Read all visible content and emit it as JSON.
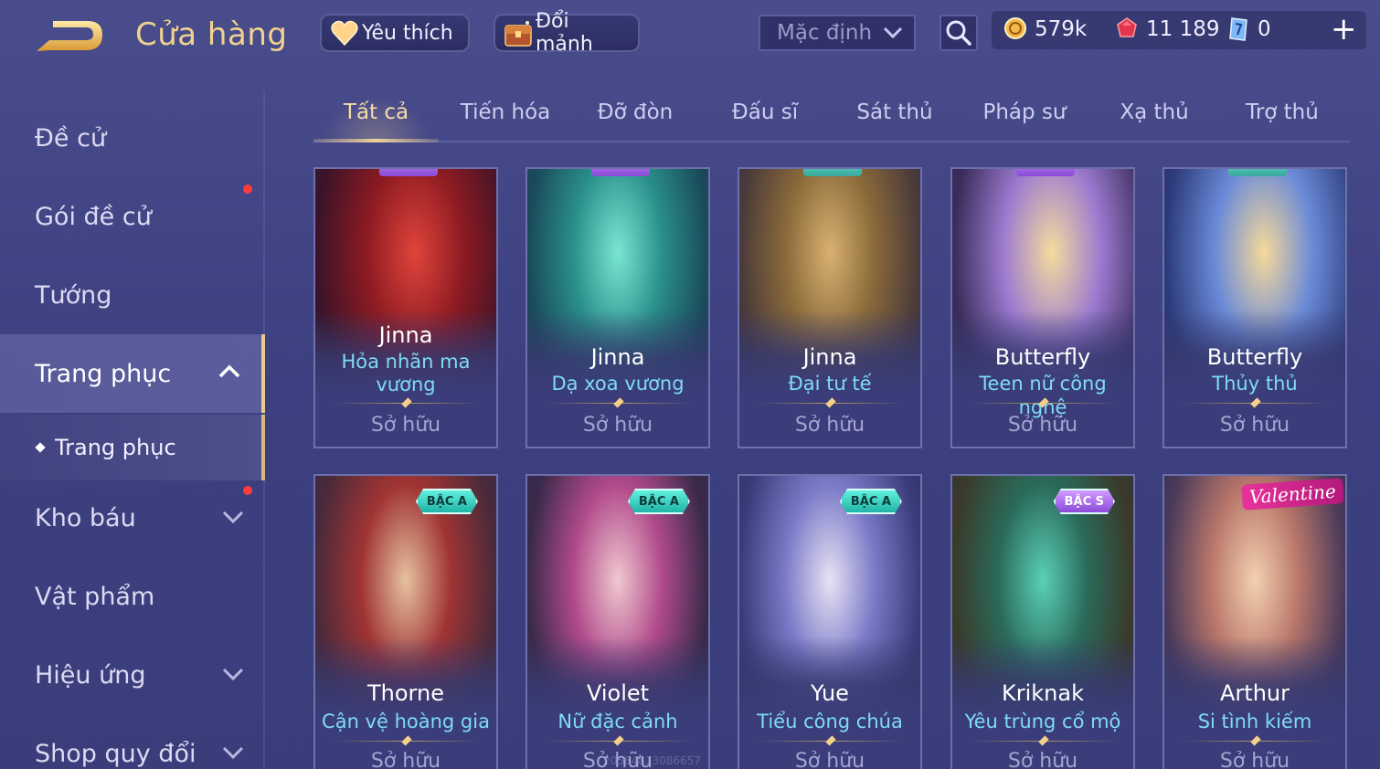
{
  "header": {
    "title": "Cửa hàng",
    "favorite_label": "Yêu thích",
    "trade_label": "Đổi mảnh",
    "sort_value": "Mặc định",
    "gold": "579k",
    "ruby": "11 189",
    "voucher": "0"
  },
  "sidebar": {
    "items": [
      {
        "label": "Đề cử"
      },
      {
        "label": "Gói đề cử",
        "badge": true
      },
      {
        "label": "Tướng"
      },
      {
        "label": "Trang phục",
        "expanded": true
      },
      {
        "label": "Kho báu",
        "badge": true
      },
      {
        "label": "Vật phẩm"
      },
      {
        "label": "Hiệu ứng"
      },
      {
        "label": "Shop quy đổi"
      }
    ],
    "sub_item": "Trang phục"
  },
  "tabs": [
    "Tất cả",
    "Tiến hóa",
    "Đỡ đòn",
    "Đấu sĩ",
    "Sát thủ",
    "Pháp sư",
    "Xạ thủ",
    "Trợ thủ"
  ],
  "active_tab": "Tất cả",
  "cards": [
    {
      "hero": "Jinna",
      "skin_line1": "Hỏa nhãn ma",
      "skin_line2": "vương",
      "status": "Sở hữu"
    },
    {
      "hero": "Jinna",
      "skin_line1": "Dạ xoa vương",
      "status": "Sở hữu"
    },
    {
      "hero": "Jinna",
      "skin_line1": "Đại tư tế",
      "status": "Sở hữu"
    },
    {
      "hero": "Butterfly",
      "skin_line1": "Teen nữ công nghệ",
      "status": "Sở hữu"
    },
    {
      "hero": "Butterfly",
      "skin_line1": "Thủy thủ",
      "status": "Sở hữu"
    },
    {
      "hero": "Thorne",
      "skin_line1": "Cận vệ hoàng gia",
      "status": "Sở hữu",
      "tier": "BẬC A"
    },
    {
      "hero": "Violet",
      "skin_line1": "Nữ đặc cảnh",
      "status": "Sở hữu",
      "tier": "BẬC A"
    },
    {
      "hero": "Yue",
      "skin_line1": "Tiểu công chúa",
      "status": "Sở hữu",
      "tier": "BẬC A"
    },
    {
      "hero": "Kriknak",
      "skin_line1": "Yêu trùng cổ mộ",
      "status": "Sở hữu",
      "tier": "BẬC S"
    },
    {
      "hero": "Arthur",
      "skin_line1": "Si tình kiếm",
      "status": "Sở hữu",
      "ribbon": "Valentine"
    }
  ],
  "watermark": "20584813086657",
  "colors": {
    "accent_gold": "#f1d28f",
    "skin_name": "#7fdcf2",
    "badge_red": "#ff3b3b",
    "background": "#3d4080"
  },
  "icons": {
    "back": "back-arrow-icon",
    "favorite": "heart-icon",
    "trade": "chest-icon",
    "dropdown": "chevron-down-icon",
    "search": "search-icon",
    "gold": "gold-coin-icon",
    "ruby": "ruby-gem-icon",
    "voucher": "voucher-icon",
    "add": "plus-icon"
  }
}
